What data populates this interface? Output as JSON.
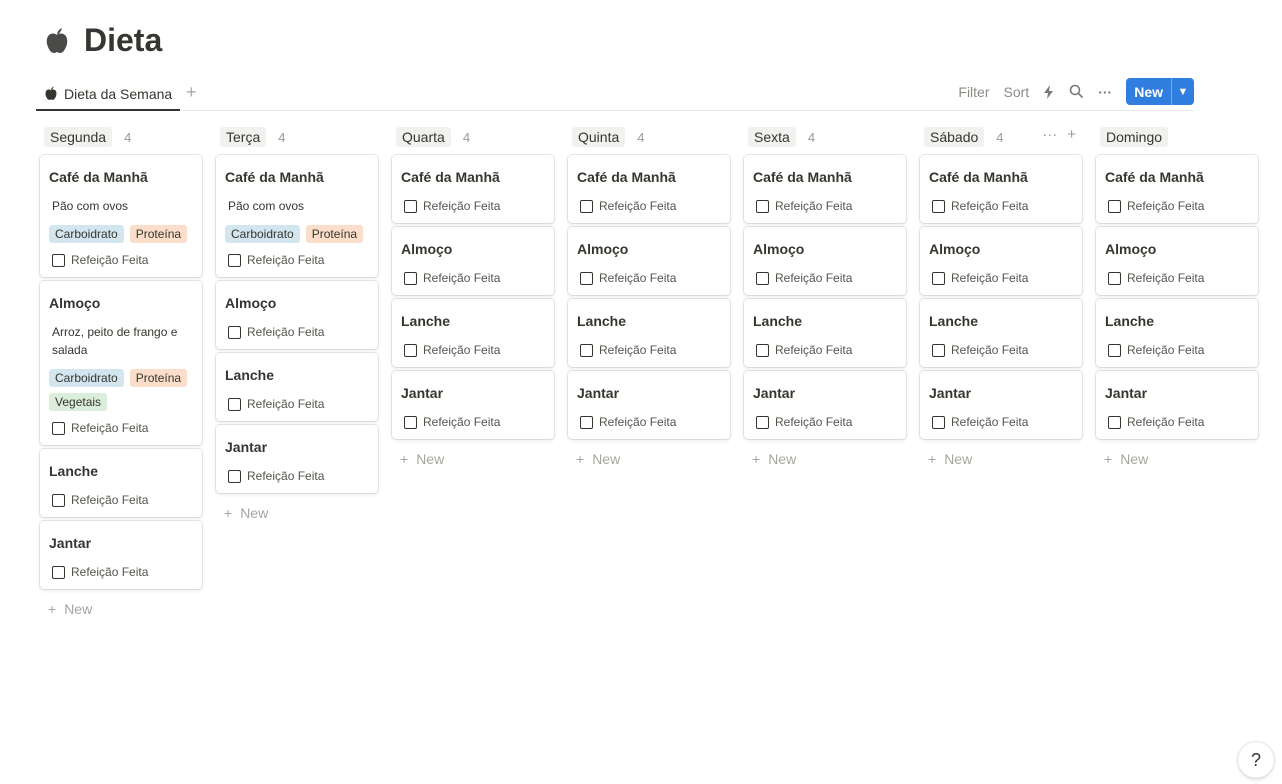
{
  "page": {
    "title": "Dieta",
    "icon": "apple-icon"
  },
  "tabs": [
    {
      "label": "Dieta da Semana",
      "icon": "apple-icon"
    }
  ],
  "toolbar": {
    "filter": "Filter",
    "sort": "Sort",
    "new": "New"
  },
  "add_new_label": "New",
  "help": "?",
  "tag_colors": {
    "Carboidrato": "#d3e5ef",
    "Proteína": "#fadec9",
    "Vegetais": "#dbeddb"
  },
  "columns": [
    {
      "name": "Segunda",
      "count": "4",
      "cards": [
        {
          "title": "Café da Manhã",
          "desc": "Pão com ovos",
          "tags": [
            "Carboidrato",
            "Proteína"
          ],
          "check": "Refeição Feita"
        },
        {
          "title": "Almoço",
          "desc": "Arroz, peito de frango e salada",
          "tags": [
            "Carboidrato",
            "Proteína",
            "Vegetais"
          ],
          "check": "Refeição Feita"
        },
        {
          "title": "Lanche",
          "check": "Refeição Feita"
        },
        {
          "title": "Jantar",
          "check": "Refeição Feita"
        }
      ]
    },
    {
      "name": "Terça",
      "count": "4",
      "cards": [
        {
          "title": "Café da Manhã",
          "desc": "Pão com ovos",
          "tags": [
            "Carboidrato",
            "Proteína"
          ],
          "check": "Refeição Feita"
        },
        {
          "title": "Almoço",
          "check": "Refeição Feita"
        },
        {
          "title": "Lanche",
          "check": "Refeição Feita"
        },
        {
          "title": "Jantar",
          "check": "Refeição Feita"
        }
      ]
    },
    {
      "name": "Quarta",
      "count": "4",
      "cards": [
        {
          "title": "Café da Manhã",
          "check": "Refeição Feita"
        },
        {
          "title": "Almoço",
          "check": "Refeição Feita"
        },
        {
          "title": "Lanche",
          "check": "Refeição Feita"
        },
        {
          "title": "Jantar",
          "check": "Refeição Feita"
        }
      ]
    },
    {
      "name": "Quinta",
      "count": "4",
      "cards": [
        {
          "title": "Café da Manhã",
          "check": "Refeição Feita"
        },
        {
          "title": "Almoço",
          "check": "Refeição Feita"
        },
        {
          "title": "Lanche",
          "check": "Refeição Feita"
        },
        {
          "title": "Jantar",
          "check": "Refeição Feita"
        }
      ]
    },
    {
      "name": "Sexta",
      "count": "4",
      "cards": [
        {
          "title": "Café da Manhã",
          "check": "Refeição Feita"
        },
        {
          "title": "Almoço",
          "check": "Refeição Feita"
        },
        {
          "title": "Lanche",
          "check": "Refeição Feita"
        },
        {
          "title": "Jantar",
          "check": "Refeição Feita"
        }
      ]
    },
    {
      "name": "Sábado",
      "count": "4",
      "cards": [
        {
          "title": "Café da Manhã",
          "check": "Refeição Feita"
        },
        {
          "title": "Almoço",
          "check": "Refeição Feita"
        },
        {
          "title": "Lanche",
          "check": "Refeição Feita"
        },
        {
          "title": "Jantar",
          "check": "Refeição Feita"
        }
      ]
    },
    {
      "name": "Domingo",
      "cards": [
        {
          "title": "Café da Manhã",
          "check": "Refeição Feita"
        },
        {
          "title": "Almoço",
          "check": "Refeição Feita"
        },
        {
          "title": "Lanche",
          "check": "Refeição Feita"
        },
        {
          "title": "Jantar",
          "check": "Refeição Feita"
        }
      ]
    }
  ]
}
